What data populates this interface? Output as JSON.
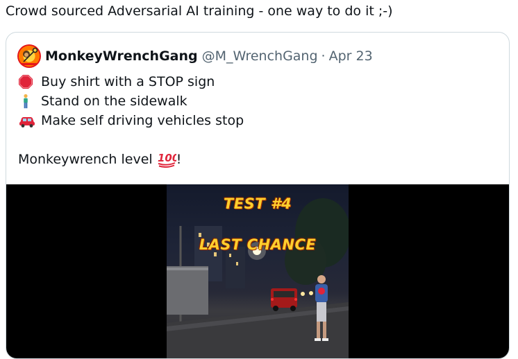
{
  "tweet": {
    "text": "Crowd sourced Adversarial AI training - one way to do it ;-)"
  },
  "quoted": {
    "display_name": "MonkeyWrenchGang",
    "handle": "@M_WrenchGang",
    "separator": "·",
    "date": "Apr 23",
    "avatar_icon": "monkey-wrench-logo",
    "lines": [
      {
        "icon": "stop-sign-emoji",
        "text": "Buy shirt with a STOP sign"
      },
      {
        "icon": "person-standing-emoji",
        "text": "Stand on the sidewalk"
      },
      {
        "icon": "car-emoji",
        "text": "Make self driving vehicles stop"
      }
    ],
    "closing_text": "Monkeywrench level",
    "closing_icon": "hundred-points-emoji",
    "closing_punct": "!",
    "media": {
      "overlay_line1": "TEST #4",
      "overlay_line2": "LAST CHANCE"
    }
  },
  "colors": {
    "text": "#0f1419",
    "secondary": "#536471",
    "border": "#cfd9de",
    "overlay": "#ffcf2e"
  }
}
